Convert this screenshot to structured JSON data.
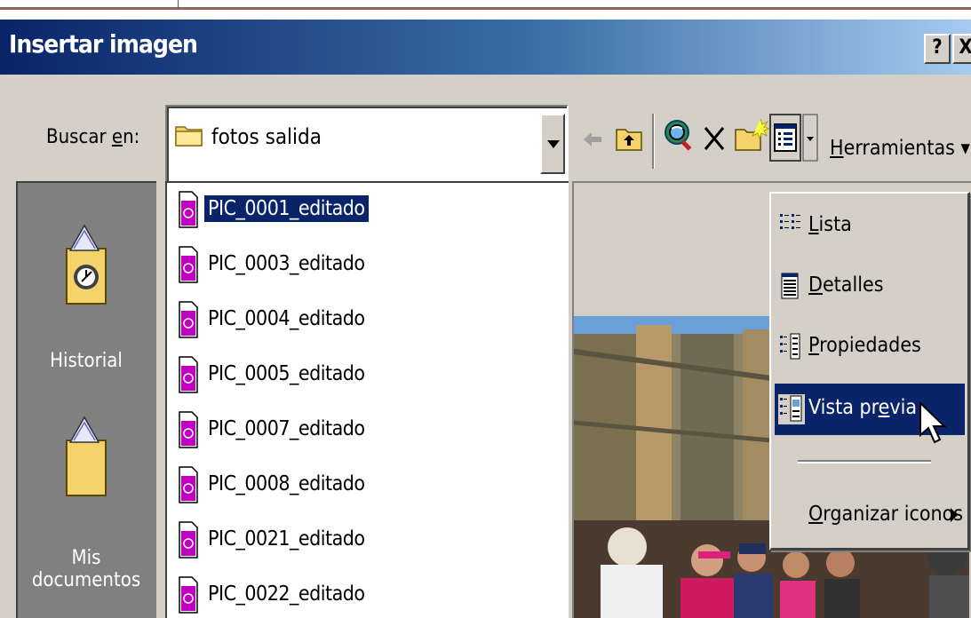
{
  "dialog": {
    "title": "Insertar imagen",
    "help_button": "?",
    "close_button": "X"
  },
  "toolbar": {
    "look_in_prefix": "Buscar ",
    "look_in_mnemonic": "e",
    "look_in_suffix": "n:",
    "current_folder": "fotos salida",
    "tools_mnemonic": "H",
    "tools_rest": "erramientas",
    "tools_arrow": "▾"
  },
  "places": [
    {
      "label": "Historial",
      "icon": "history-folder-icon"
    },
    {
      "label": "Mis documentos",
      "icon": "my-documents-folder-icon"
    }
  ],
  "files": [
    {
      "name": "PIC_0001_editado",
      "selected": true
    },
    {
      "name": "PIC_0003_editado",
      "selected": false
    },
    {
      "name": "PIC_0004_editado",
      "selected": false
    },
    {
      "name": "PIC_0005_editado",
      "selected": false
    },
    {
      "name": "PIC_0007_editado",
      "selected": false
    },
    {
      "name": "PIC_0008_editado",
      "selected": false
    },
    {
      "name": "PIC_0021_editado",
      "selected": false
    },
    {
      "name": "PIC_0022_editado",
      "selected": false
    }
  ],
  "views_menu": {
    "items": [
      {
        "mnemonic": "L",
        "rest": "ista",
        "icon": "list-view-icon",
        "highlighted": false
      },
      {
        "mnemonic": "D",
        "rest": "etalles",
        "icon": "details-view-icon",
        "highlighted": false
      },
      {
        "mnemonic": "P",
        "rest": "ropiedades",
        "icon": "properties-view-icon",
        "highlighted": false
      },
      {
        "prefix": "Vista pr",
        "mnemonic": "e",
        "rest": "via",
        "icon": "preview-view-icon",
        "highlighted": true
      }
    ],
    "arrange": {
      "mnemonic": "O",
      "rest": "rganizar iconos"
    }
  },
  "colors": {
    "title_gradient_start": "#0a246a",
    "title_gradient_end": "#a6caf0",
    "selection": "#0a246a",
    "dialog_face": "#d4d0c8",
    "places_bar": "#808080",
    "file_icon": "#c000c0"
  }
}
